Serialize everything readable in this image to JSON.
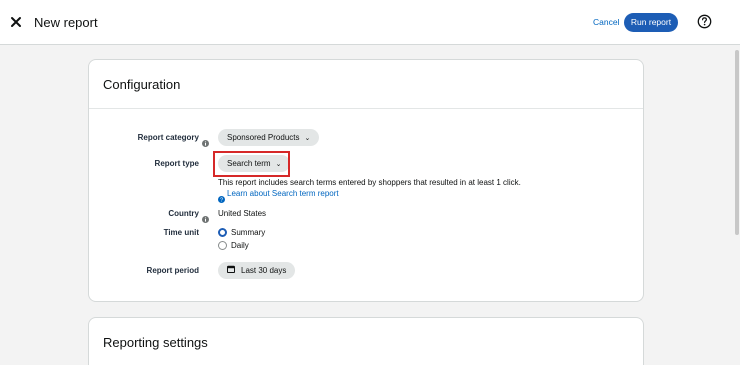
{
  "header": {
    "title": "New report",
    "cancel_label": "Cancel",
    "run_label": "Run report"
  },
  "configuration": {
    "title": "Configuration",
    "report_category": {
      "label": "Report category",
      "value": "Sponsored Products"
    },
    "report_type": {
      "label": "Report type",
      "value": "Search term",
      "description": "This report includes search terms entered by shoppers that resulted in at least 1 click.",
      "learn_link": "Learn about Search term report"
    },
    "country": {
      "label": "Country",
      "value": "United States"
    },
    "time_unit": {
      "label": "Time unit",
      "options": [
        {
          "label": "Summary",
          "selected": true
        },
        {
          "label": "Daily",
          "selected": false
        }
      ]
    },
    "report_period": {
      "label": "Report period",
      "value": "Last 30 days"
    }
  },
  "reporting_settings": {
    "title": "Reporting settings"
  },
  "colors": {
    "accent": "#1d5db5",
    "link": "#0066c0",
    "highlight_border": "#d62828",
    "pill_bg": "#e3e6e6"
  }
}
